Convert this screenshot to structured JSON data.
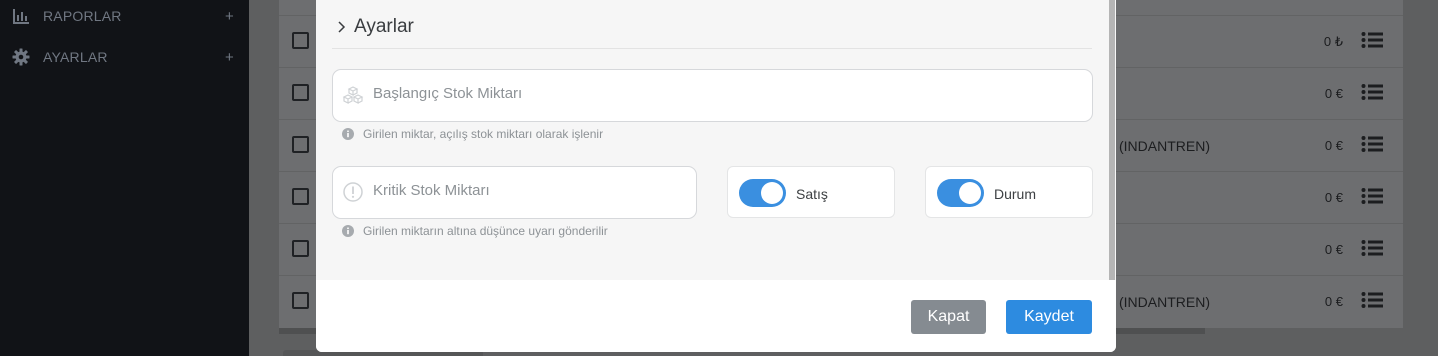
{
  "sidebar": {
    "items": [
      {
        "label": "RAPORLAR",
        "icon": "bar-chart-icon",
        "expand": "+"
      },
      {
        "label": "AYARLAR",
        "icon": "gear-icon",
        "expand": "+"
      }
    ]
  },
  "background_table": {
    "rows": [
      {
        "text": "",
        "price": "0 ₺"
      },
      {
        "text": "",
        "price": "0 €"
      },
      {
        "text": "(INDANTREN)",
        "price": "0 €"
      },
      {
        "text": "",
        "price": "0 €"
      },
      {
        "text": "",
        "price": "0 €"
      },
      {
        "text": "(INDANTREN)",
        "price": "0 €"
      }
    ]
  },
  "modal": {
    "section": {
      "title": "Ayarlar",
      "icon": "chevron-right-icon"
    },
    "initial_stock": {
      "placeholder": "Başlangıç Stok Miktarı",
      "icon": "cubes-icon",
      "hint": "Girilen miktar, açılış stok miktarı olarak işlenir"
    },
    "critical_stock": {
      "placeholder": "Kritik Stok Miktarı",
      "icon": "exclamation-circle-icon",
      "hint": "Girilen miktarın altına düşünce uyarı gönderilir"
    },
    "toggles": [
      {
        "label": "Satış",
        "on": true
      },
      {
        "label": "Durum",
        "on": true
      }
    ],
    "footer": {
      "close_label": "Kapat",
      "save_label": "Kaydet"
    }
  },
  "colors": {
    "accent": "#2d8be0",
    "toggle_on": "#3a8fe0",
    "close_button": "#858b91",
    "sidebar_bg": "#111317"
  }
}
